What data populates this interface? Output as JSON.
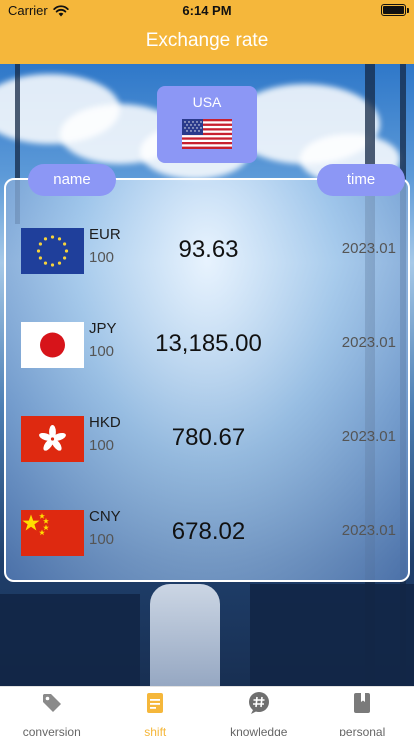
{
  "status_bar": {
    "carrier": "Carrier",
    "time": "6:14 PM"
  },
  "nav": {
    "title": "Exchange rate"
  },
  "base_currency": {
    "label": "USA"
  },
  "columns": {
    "name": "name",
    "time": "time"
  },
  "rates": [
    {
      "code": "EUR",
      "base": "100",
      "value": "93.63",
      "date": "2023.01",
      "flag": "eu-flag"
    },
    {
      "code": "JPY",
      "base": "100",
      "value": "13,185.00",
      "date": "2023.01",
      "flag": "japan-flag"
    },
    {
      "code": "HKD",
      "base": "100",
      "value": "780.67",
      "date": "2023.01",
      "flag": "hong-kong-flag"
    },
    {
      "code": "CNY",
      "base": "100",
      "value": "678.02",
      "date": "2023.01",
      "flag": "china-flag"
    }
  ],
  "tabs": [
    {
      "label": "conversion",
      "icon": "tag-icon",
      "active": false
    },
    {
      "label": "shift",
      "icon": "document-icon",
      "active": true
    },
    {
      "label": "knowledge",
      "icon": "hashtag-icon",
      "active": false
    },
    {
      "label": "personal",
      "icon": "bookmark-book-icon",
      "active": false
    }
  ],
  "colors": {
    "accent": "#f5b73b",
    "pill": "#8c97f5",
    "tab_inactive": "#666666"
  }
}
